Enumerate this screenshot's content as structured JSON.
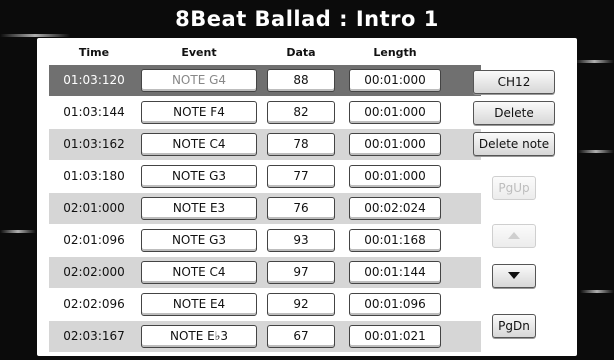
{
  "title": "8Beat Ballad : Intro 1",
  "headers": {
    "time": "Time",
    "event": "Event",
    "data": "Data",
    "length": "Length"
  },
  "rows": [
    {
      "time": "01:03:120",
      "event": "NOTE G4",
      "data": "88",
      "length": "00:01:000"
    },
    {
      "time": "01:03:144",
      "event": "NOTE F4",
      "data": "82",
      "length": "00:01:000"
    },
    {
      "time": "01:03:162",
      "event": "NOTE C4",
      "data": "78",
      "length": "00:01:000"
    },
    {
      "time": "01:03:180",
      "event": "NOTE G3",
      "data": "77",
      "length": "00:01:000"
    },
    {
      "time": "02:01:000",
      "event": "NOTE E3",
      "data": "76",
      "length": "00:02:024"
    },
    {
      "time": "02:01:096",
      "event": "NOTE G3",
      "data": "93",
      "length": "00:01:168"
    },
    {
      "time": "02:02:000",
      "event": "NOTE C4",
      "data": "97",
      "length": "00:01:144"
    },
    {
      "time": "02:02:096",
      "event": "NOTE E4",
      "data": "92",
      "length": "00:01:096"
    },
    {
      "time": "02:03:167",
      "event": "NOTE E♭3",
      "data": "67",
      "length": "00:01:021"
    }
  ],
  "selected_row": 0,
  "side": {
    "ch": "CH12",
    "delete": "Delete",
    "delete_note": "Delete note",
    "pgup": "PgUp",
    "pgdn": "PgDn",
    "up_icon": "triangle-up-icon",
    "down_icon": "triangle-down-icon"
  }
}
